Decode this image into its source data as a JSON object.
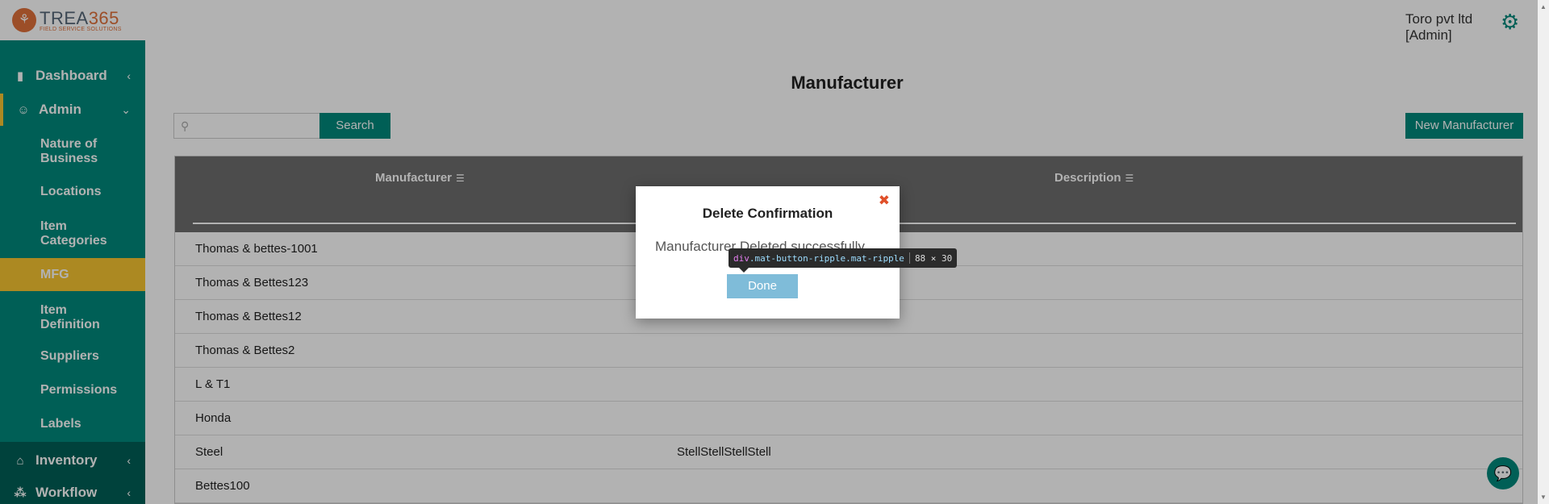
{
  "brand": {
    "logo_prefix": "TREA",
    "logo_accent": "365",
    "tagline": "FIELD SERVICE SOLUTIONS",
    "accent_color": "#e0703a"
  },
  "sidebar": {
    "dashboard": {
      "label": "Dashboard",
      "icon": "bar-chart-icon"
    },
    "admin": {
      "label": "Admin",
      "icon": "user-gear-icon"
    },
    "admin_items": [
      {
        "label": "Nature of Business"
      },
      {
        "label": "Locations"
      },
      {
        "label": "Item Categories"
      },
      {
        "label": "MFG",
        "active": true
      },
      {
        "label": "Item Definition"
      },
      {
        "label": "Suppliers"
      },
      {
        "label": "Permissions"
      },
      {
        "label": "Labels"
      }
    ],
    "inventory": {
      "label": "Inventory",
      "icon": "home-icon"
    },
    "workflow": {
      "label": "Workflow",
      "icon": "workflow-icon"
    },
    "primary_color": "#00897b",
    "active_color": "#f6c531"
  },
  "header": {
    "company": "Toro pvt ltd",
    "role": "[Admin]"
  },
  "page": {
    "title": "Manufacturer",
    "search_placeholder": "",
    "search_label": "Search",
    "new_label": "New Manufacturer"
  },
  "table": {
    "columns": [
      "Manufacturer",
      "Description"
    ],
    "rows": [
      [
        "Thomas & bettes-1001",
        ""
      ],
      [
        "Thomas & Bettes123",
        ""
      ],
      [
        "Thomas & Bettes12",
        ""
      ],
      [
        "Thomas & Bettes2",
        ""
      ],
      [
        "L & T1",
        ""
      ],
      [
        "Honda",
        ""
      ],
      [
        "Steel",
        "StellStellStellStell"
      ],
      [
        "Bettes100",
        ""
      ]
    ]
  },
  "dialog": {
    "title": "Delete Confirmation",
    "message": "Manufacturer Deleted successfully",
    "done_label": "Done"
  },
  "devtools_tooltip": {
    "tag": "div",
    "selector": ".mat-button-ripple.mat-ripple",
    "size": "88 × 30"
  }
}
